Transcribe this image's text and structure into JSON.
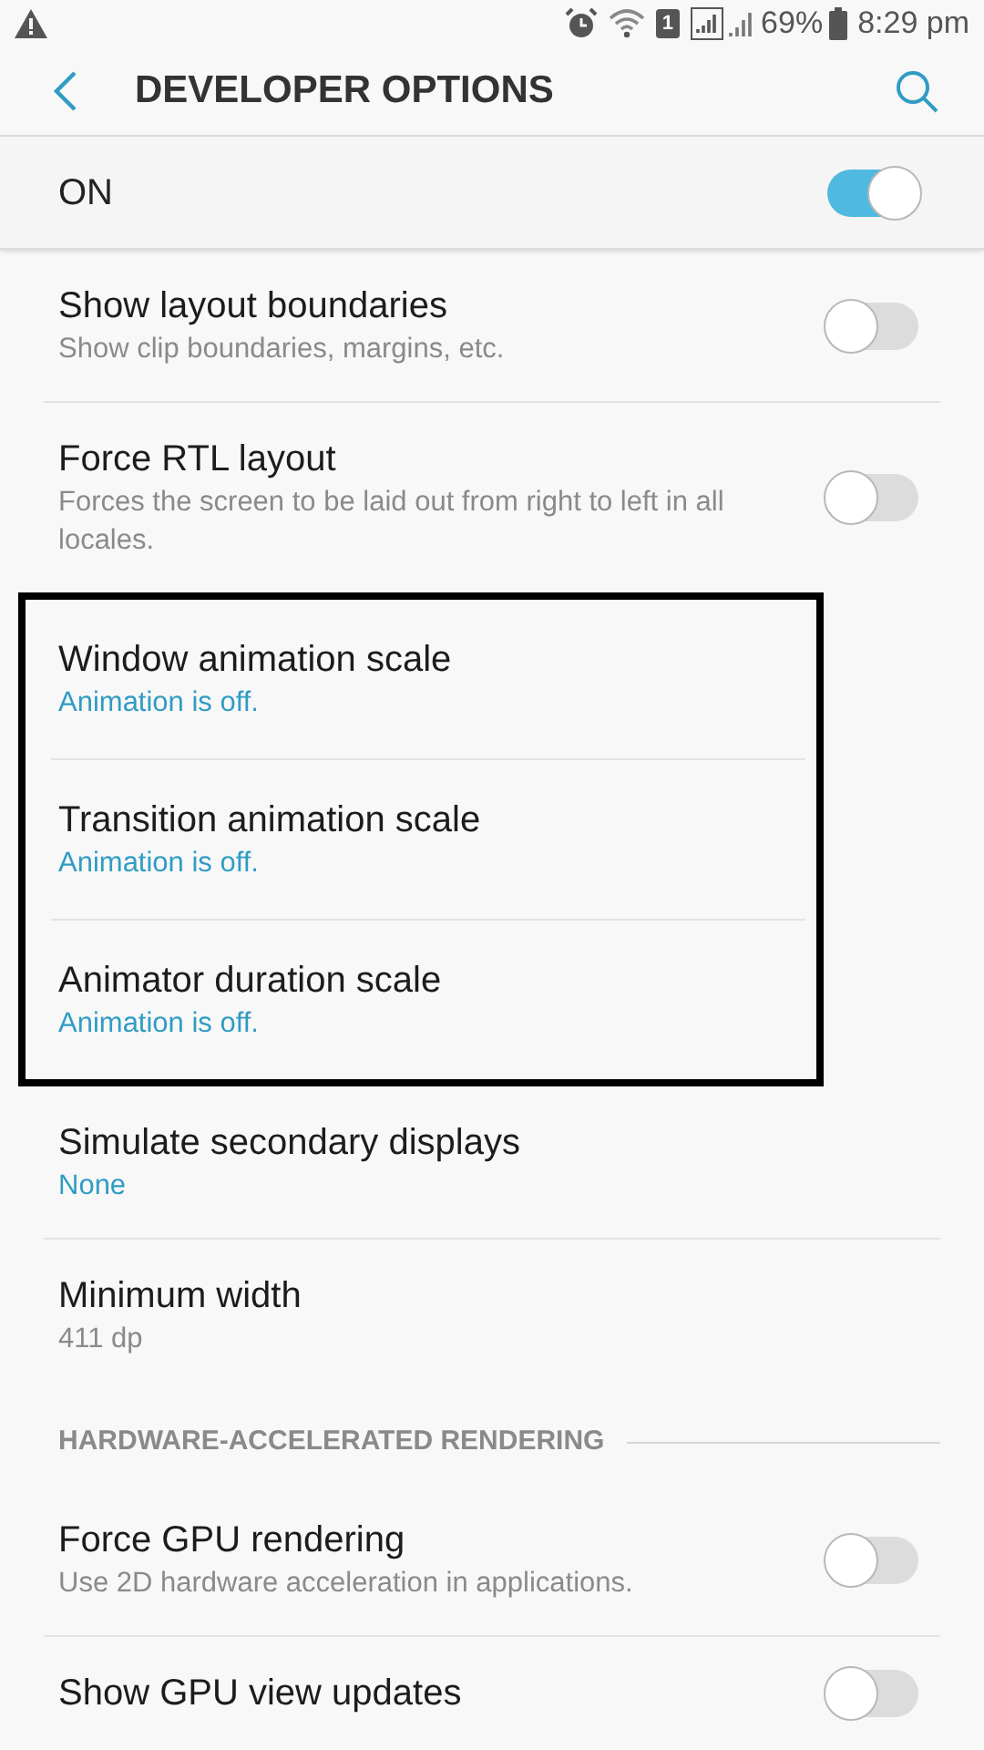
{
  "status_bar": {
    "battery": "69%",
    "time": "8:29 pm",
    "sim_slot": "1"
  },
  "header": {
    "title": "DEVELOPER OPTIONS"
  },
  "master_switch": {
    "label": "ON",
    "on": true
  },
  "items": [
    {
      "kind": "toggle",
      "title": "Show layout boundaries",
      "subtitle": "Show clip boundaries, margins, etc.",
      "on": false,
      "highlighted": false
    },
    {
      "kind": "toggle",
      "title": "Force RTL layout",
      "subtitle": "Forces the screen to be laid out from right to left in all locales.",
      "on": false,
      "highlighted": false
    },
    {
      "kind": "choice",
      "title": "Window animation scale",
      "subtitle": "Animation is off.",
      "highlighted": true
    },
    {
      "kind": "choice",
      "title": "Transition animation scale",
      "subtitle": "Animation is off.",
      "highlighted": true
    },
    {
      "kind": "choice",
      "title": "Animator duration scale",
      "subtitle": "Animation is off.",
      "highlighted": true
    },
    {
      "kind": "choice",
      "title": "Simulate secondary displays",
      "subtitle": "None",
      "highlighted": false
    },
    {
      "kind": "info",
      "title": "Minimum width",
      "subtitle": "411 dp",
      "highlighted": false
    },
    {
      "kind": "section",
      "title": "HARDWARE-ACCELERATED RENDERING",
      "highlighted": false
    },
    {
      "kind": "toggle",
      "title": "Force GPU rendering",
      "subtitle": "Use 2D hardware acceleration in applications.",
      "on": false,
      "highlighted": false
    },
    {
      "kind": "toggle",
      "title": "Show GPU view updates",
      "on": false,
      "highlighted": false
    }
  ]
}
